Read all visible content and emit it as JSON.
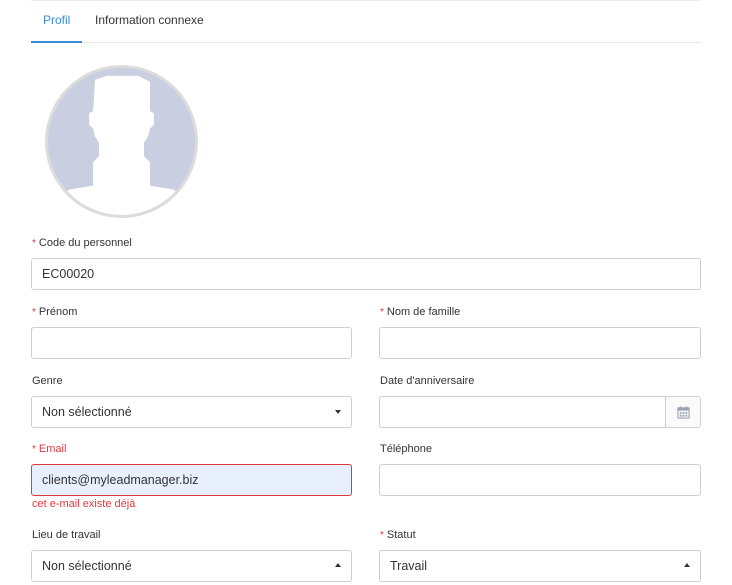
{
  "tabs": [
    {
      "label": "Profil",
      "active": true
    },
    {
      "label": "Information connexe",
      "active": false
    }
  ],
  "avatar": {
    "icon": "user-silhouette-icon"
  },
  "form": {
    "code": {
      "label": "Code du personnel",
      "required": true,
      "value": "EC00020"
    },
    "prenom": {
      "label": "Prénom",
      "required": true,
      "value": ""
    },
    "nom": {
      "label": "Nom de famille",
      "required": true,
      "value": ""
    },
    "genre": {
      "label": "Genre",
      "value": "Non sélectionné"
    },
    "date": {
      "label": "Date d'anniversaire",
      "value": "",
      "icon": "calendar-icon"
    },
    "email": {
      "label": "Email",
      "required": true,
      "value": "clients@myleadmanager.biz",
      "error": "cet e-mail existe déjà"
    },
    "telephone": {
      "label": "Téléphone",
      "value": ""
    },
    "lieu": {
      "label": "Lieu de travail",
      "value": "Non sélectionné"
    },
    "statut": {
      "label": "Statut",
      "required": true,
      "value": "Travail"
    }
  },
  "colors": {
    "accent": "#3a8bd6",
    "error": "#e0393e",
    "avatar_bg": "#c9cfe0"
  }
}
